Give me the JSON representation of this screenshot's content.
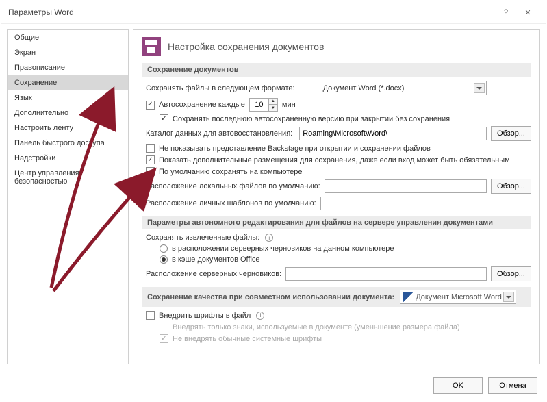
{
  "titlebar": {
    "title": "Параметры Word",
    "help": "?",
    "close": "✕"
  },
  "sidebar": {
    "items": [
      "Общие",
      "Экран",
      "Правописание",
      "Сохранение",
      "Язык",
      "Дополнительно",
      "Настроить ленту",
      "Панель быстрого доступа",
      "Надстройки",
      "Центр управления безопасностью"
    ],
    "active_index": 3
  },
  "header": {
    "title": "Настройка сохранения документов"
  },
  "sections": {
    "save_docs": "Сохранение документов",
    "offline": "Параметры автономного редактирования для файлов на сервере управления документами",
    "fidelity": "Сохранение качества при совместном использовании документа:"
  },
  "save": {
    "format_label": "Сохранять файлы в следующем формате:",
    "format_value": "Документ Word (*.docx)",
    "autosave_label": "Автосохранение каждые",
    "autosave_value": "10",
    "autosave_unit": "мин",
    "keep_last_label": "Сохранять последнюю автосохраненную версию при закрытии без сохранения",
    "autorecover_label": "Каталог данных для автовосстановления:",
    "autorecover_path": "Roaming\\Microsoft\\Word\\",
    "browse": "Обзор...",
    "no_backstage": "Не показывать представление Backstage при открытии и сохранении файлов",
    "show_additional": "Показать дополнительные размещения для сохранения, даже если вход может быть обязательным",
    "default_local": "По умолчанию сохранять на компьютере",
    "local_files_label": "Расположение локальных файлов по умолчанию:",
    "local_files_value": "",
    "templates_label": "Расположение личных шаблонов по умолчанию:",
    "templates_value": ""
  },
  "offline": {
    "checked_out_label": "Сохранять извлеченные файлы:",
    "opt_server": "в расположении серверных черновиков на данном компьютере",
    "opt_cache": "в кэше документов Office",
    "drafts_label": "Расположение серверных черновиков:",
    "drafts_value": "",
    "browse": "Обзор..."
  },
  "fidelity": {
    "doc_sel": "Документ Microsoft Word",
    "embed_fonts": "Внедрить шрифты в файл",
    "embed_subset": "Внедрять только знаки, используемые в документе (уменьшение размера файла)",
    "no_system": "Не внедрять обычные системные шрифты"
  },
  "footer": {
    "ok": "OK",
    "cancel": "Отмена"
  }
}
